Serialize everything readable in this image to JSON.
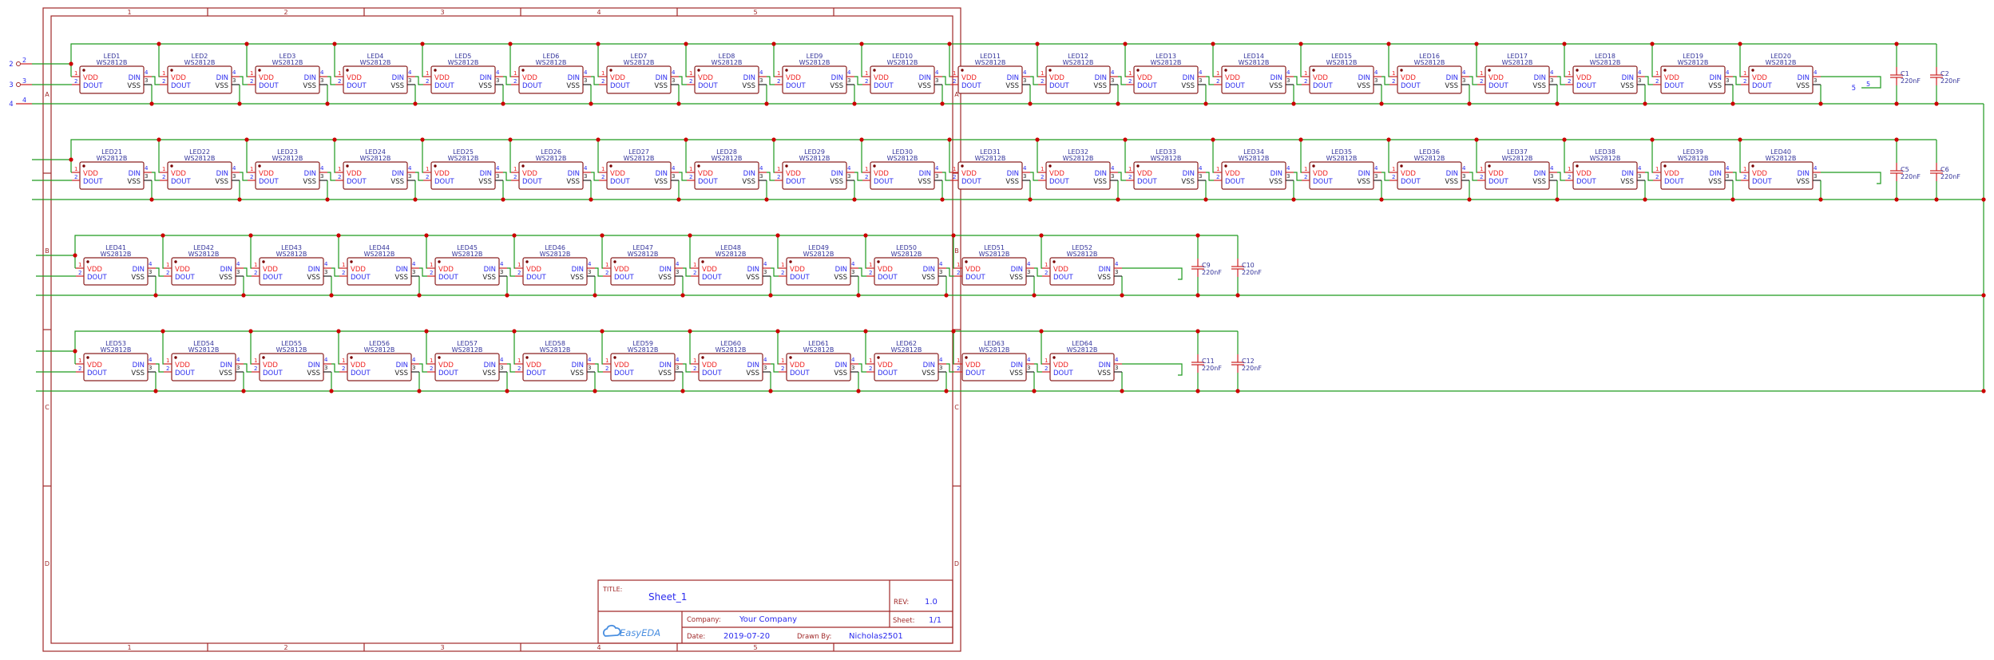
{
  "sheet": {
    "columns": [
      "1",
      "2",
      "3",
      "4",
      "5"
    ],
    "rows": [
      "A",
      "B",
      "C",
      "D"
    ]
  },
  "input_ports": [
    {
      "label": "2",
      "pin": "2"
    },
    {
      "label": "3",
      "pin": "3"
    },
    {
      "label": "4",
      "pin": "4"
    }
  ],
  "output_port": {
    "label": "5",
    "pin": "5"
  },
  "part_value": "WS2812B",
  "pins": {
    "vdd": "VDD",
    "dout": "DOUT",
    "din": "DIN",
    "vss": "VSS",
    "n1": "1",
    "n2": "2",
    "n3": "3",
    "n4": "4"
  },
  "led_rows": [
    [
      "LED1",
      "LED2",
      "LED3",
      "LED4",
      "LED5",
      "LED6",
      "LED7",
      "LED8",
      "LED9",
      "LED10",
      "LED11",
      "LED12",
      "LED13",
      "LED14",
      "LED15",
      "LED16",
      "LED17",
      "LED18",
      "LED19",
      "LED20"
    ],
    [
      "LED21",
      "LED22",
      "LED23",
      "LED24",
      "LED25",
      "LED26",
      "LED27",
      "LED28",
      "LED29",
      "LED30",
      "LED31",
      "LED32",
      "LED33",
      "LED34",
      "LED35",
      "LED36",
      "LED37",
      "LED38",
      "LED39",
      "LED40"
    ],
    [
      "LED41",
      "LED42",
      "LED43",
      "LED44",
      "LED45",
      "LED46",
      "LED47",
      "LED48",
      "LED49",
      "LED50",
      "LED51",
      "LED52"
    ],
    [
      "LED53",
      "LED54",
      "LED55",
      "LED56",
      "LED57",
      "LED58",
      "LED59",
      "LED60",
      "LED61",
      "LED62",
      "LED63",
      "LED64"
    ]
  ],
  "capacitor_rows": [
    [
      {
        "name": "C1",
        "value": "220nF"
      },
      {
        "name": "C2",
        "value": "220nF"
      }
    ],
    [
      {
        "name": "C5",
        "value": "220nF"
      },
      {
        "name": "C6",
        "value": "220nF"
      }
    ],
    [
      {
        "name": "C9",
        "value": "220nF"
      },
      {
        "name": "C10",
        "value": "220nF"
      }
    ],
    [
      {
        "name": "C11",
        "value": "220nF"
      },
      {
        "name": "C12",
        "value": "220nF"
      }
    ]
  ],
  "title_block": {
    "title_label": "TITLE:",
    "title": "Sheet_1",
    "rev_label": "REV:",
    "rev": "1.0",
    "company_label": "Company:",
    "company": "Your Company",
    "sheet_label": "Sheet:",
    "sheet": "1/1",
    "date_label": "Date:",
    "date": "2019-07-20",
    "drawn_label": "Drawn By:",
    "drawn_by": "Nicholas2501",
    "logo": "EasyEDA"
  },
  "colors": {
    "wire": "#1e9a1e",
    "frame": "#a02828",
    "junction": "#cc0000",
    "pin_red": "#ee2222",
    "pin_blue": "#2a2aee",
    "label": "#33339a"
  }
}
